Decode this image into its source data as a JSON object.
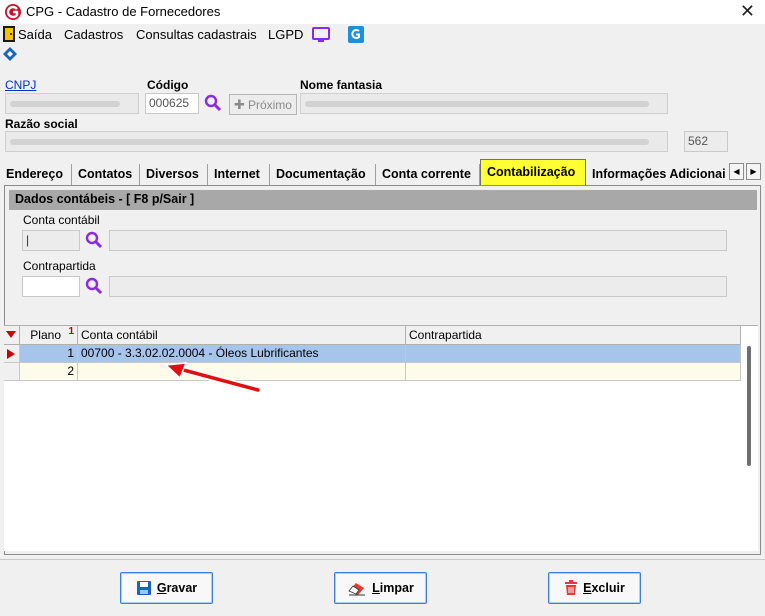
{
  "window": {
    "title": "CPG - Cadastro de Fornecedores"
  },
  "menu": {
    "items": [
      "Saída",
      "Cadastros",
      "Consultas cadastrais",
      "LGPD"
    ]
  },
  "form": {
    "cnpj_label": "CNPJ",
    "codigo_label": "Código",
    "codigo_value": "000625",
    "proximo_label": "Próximo",
    "nome_fantasia_label": "Nome fantasia",
    "razao_social_label": "Razão social",
    "razao_extra_value": "562"
  },
  "tabs": [
    {
      "label": "Endereço"
    },
    {
      "label": "Contatos"
    },
    {
      "label": "Diversos"
    },
    {
      "label": "Internet"
    },
    {
      "label": "Documentação"
    },
    {
      "label": "Conta corrente"
    },
    {
      "label": "Contabilização"
    },
    {
      "label": "Informações Adicionai"
    }
  ],
  "panel": {
    "title": "Dados contábeis - [ F8 p/Sair ]",
    "conta_contabil_label": "Conta contábil",
    "contrapartida_label": "Contrapartida"
  },
  "grid": {
    "headers": [
      "Plano",
      "Conta contábil",
      "Contrapartida"
    ],
    "sort_marker": "1",
    "rows": [
      {
        "plano": "1",
        "conta": "00700 - 3.3.02.02.0004 - Óleos Lubrificantes",
        "contrapartida": ""
      },
      {
        "plano": "2",
        "conta": "",
        "contrapartida": ""
      }
    ]
  },
  "buttons": {
    "gravar": {
      "first": "G",
      "rest": "ravar"
    },
    "limpar": {
      "first": "L",
      "rest": "impar"
    },
    "excluir": {
      "first": "E",
      "rest": "xcluir"
    }
  },
  "colors": {
    "active_tab": "#ffff33",
    "selected_row": "#a7c4ea",
    "accent_purple": "#8a2be2",
    "link_blue": "#0033cc"
  }
}
